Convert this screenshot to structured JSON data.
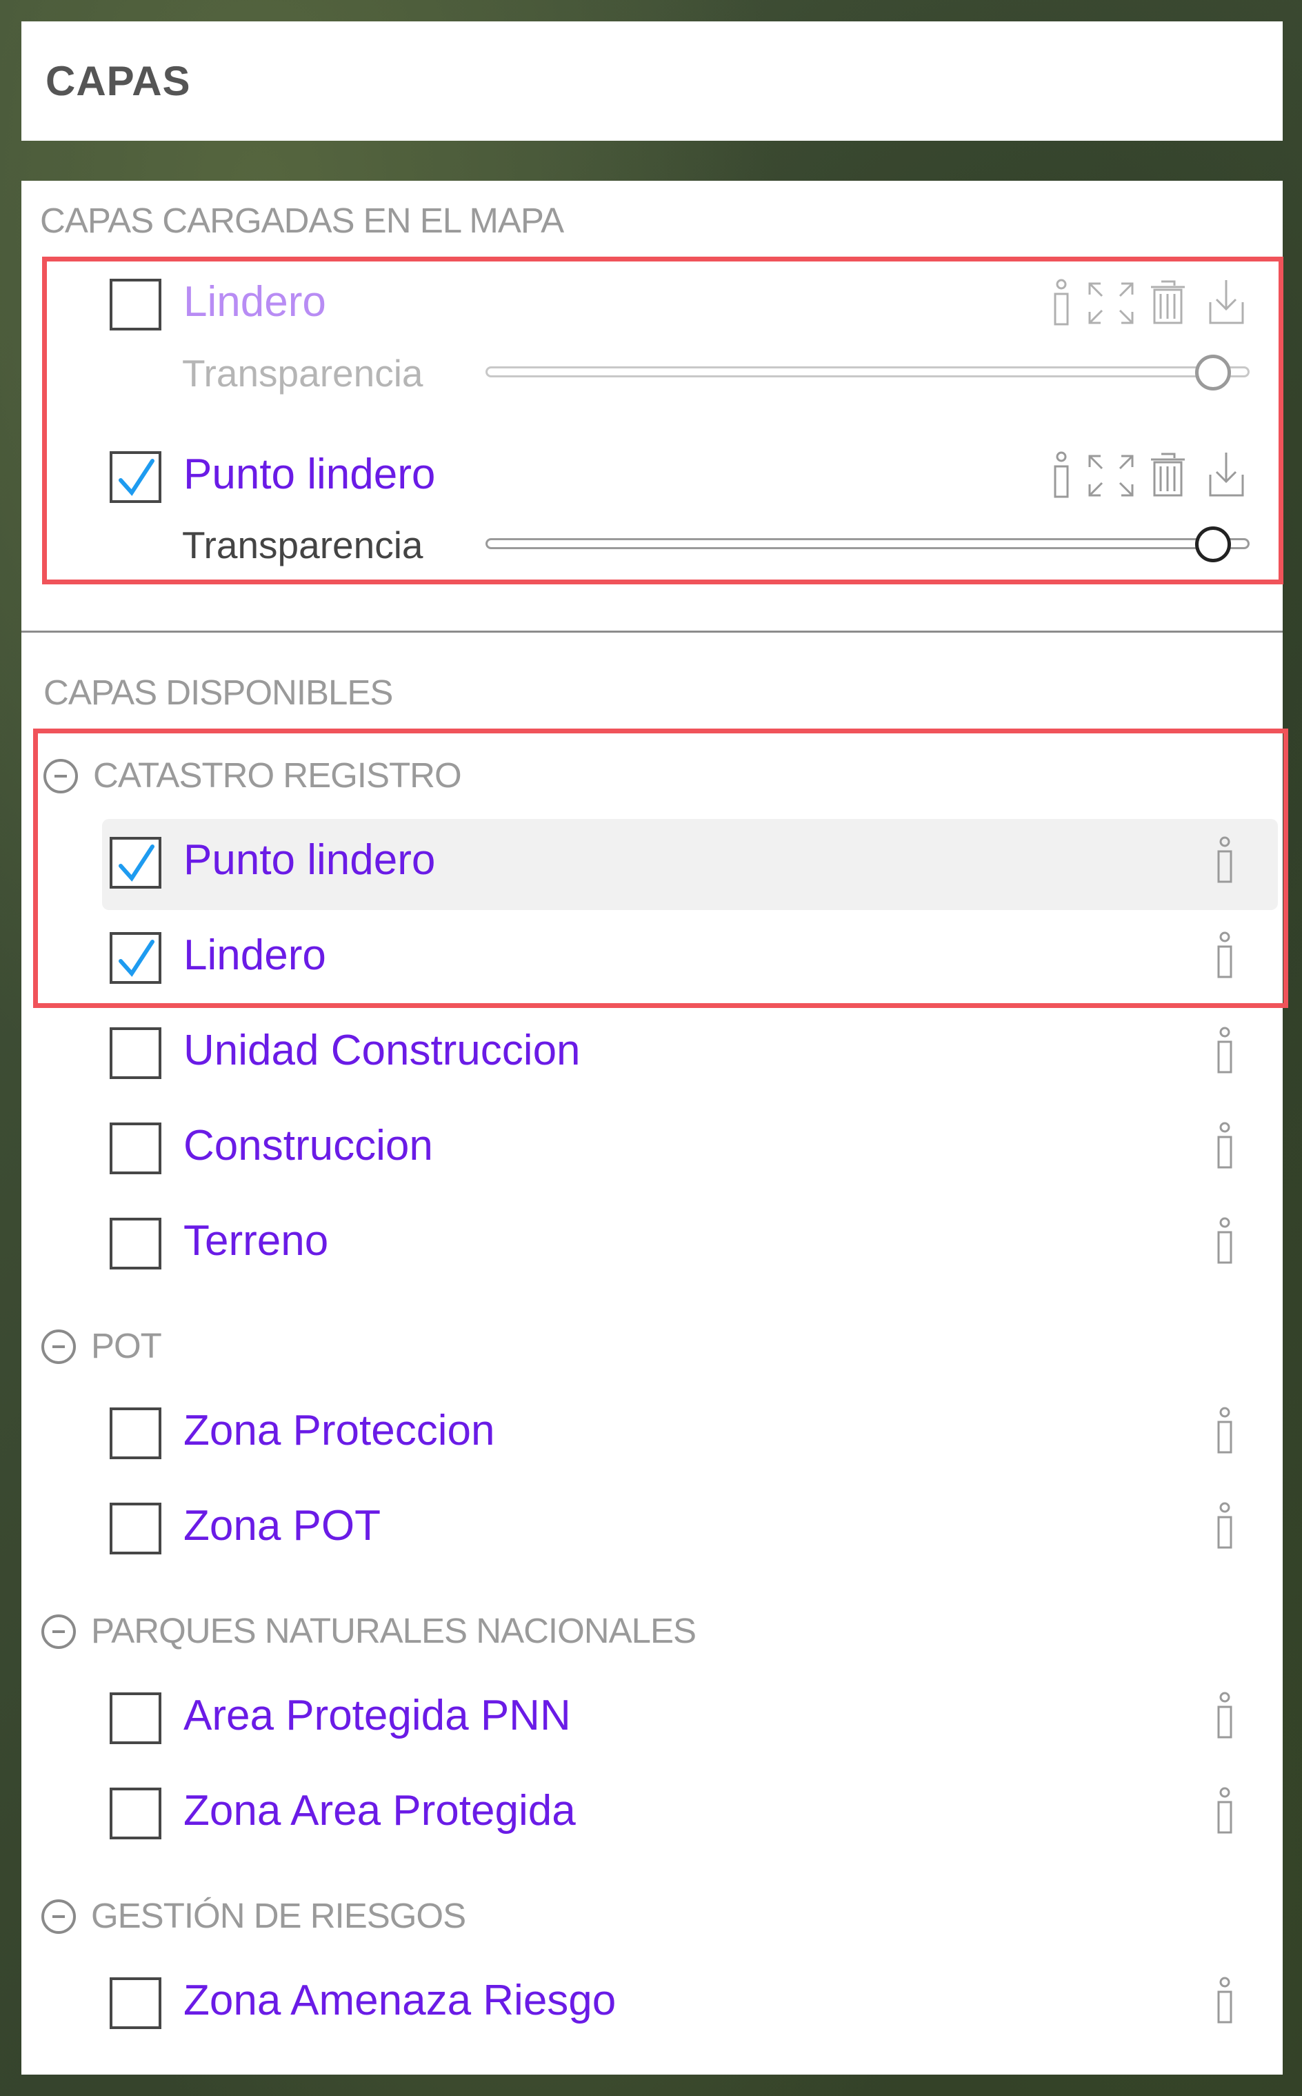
{
  "header": {
    "title": "CAPAS"
  },
  "loaded": {
    "section_title": "CAPAS CARGADAS EN EL MAPA",
    "layers": [
      {
        "name": "Lindero",
        "checked": false,
        "transparency_label": "Transparencia",
        "transparency_value": 1.0
      },
      {
        "name": "Punto lindero",
        "checked": true,
        "transparency_label": "Transparencia",
        "transparency_value": 1.0
      }
    ]
  },
  "available": {
    "section_title": "CAPAS DISPONIBLES",
    "groups": [
      {
        "title": "CATASTRO REGISTRO",
        "layers": [
          {
            "name": "Punto lindero",
            "checked": true
          },
          {
            "name": "Lindero",
            "checked": true
          },
          {
            "name": "Unidad Construccion",
            "checked": false
          },
          {
            "name": "Construccion",
            "checked": false
          },
          {
            "name": "Terreno",
            "checked": false
          }
        ]
      },
      {
        "title": "POT",
        "layers": [
          {
            "name": "Zona Proteccion",
            "checked": false
          },
          {
            "name": "Zona POT",
            "checked": false
          }
        ]
      },
      {
        "title": "PARQUES NATURALES NACIONALES",
        "layers": [
          {
            "name": "Area Protegida PNN",
            "checked": false
          },
          {
            "name": "Zona Area Protegida",
            "checked": false
          }
        ]
      },
      {
        "title": "GESTIÓN DE RIESGOS",
        "layers": [
          {
            "name": "Zona Amenaza Riesgo",
            "checked": false
          }
        ]
      }
    ]
  },
  "colors": {
    "accent_text": "#6a1be6",
    "checkmark": "#1e9bf0",
    "highlight_border": "#f0535a"
  },
  "icons": [
    "info-icon",
    "zoom-extent-icon",
    "trash-icon",
    "download-icon",
    "collapse-icon",
    "check-icon"
  ]
}
